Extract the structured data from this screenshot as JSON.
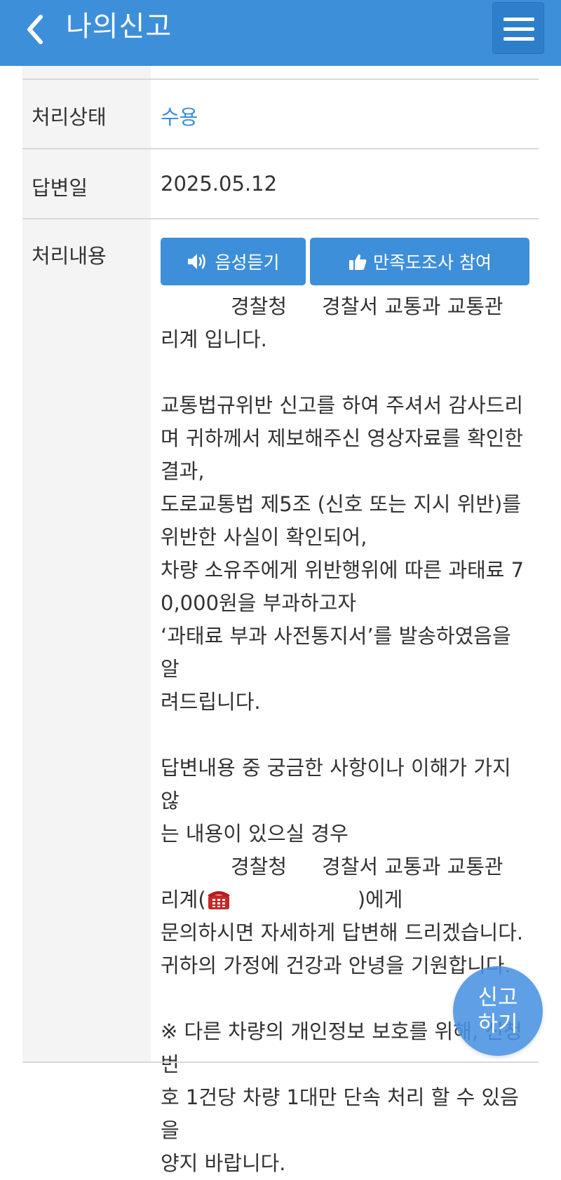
{
  "header": {
    "title": "나의신고"
  },
  "detail": {
    "rows": [
      {
        "label": "처리상태",
        "value": "수용"
      },
      {
        "label": "답변일",
        "value": "2025.05.12"
      },
      {
        "label": "처리내용"
      }
    ]
  },
  "buttons": {
    "audio_label": "음성듣기",
    "survey_label": "만족도조사 참여"
  },
  "content_lines": {
    "l1_a": "경찰청",
    "l1_b": "경찰서 교통과 교통관",
    "l2": "리계 입니다.",
    "l3": "교통법규위반 신고를 하여 주셔서 감사드리",
    "l4": "며 귀하께서 제보해주신 영상자료를 확인한",
    "l5": "결과,",
    "l6": "도로교통법 제5조 (신호 또는 지시 위반)를",
    "l7": "위반한 사실이 확인되어,",
    "l8": "차량 소유주에게 위반행위에 따른 과태료 7",
    "l9": "0,000원을 부과하고자",
    "l10": "‘과태료 부과 사전통지서’를 발송하였음을 알",
    "l11": "려드립니다.",
    "l12": "답변내용 중 궁금한 사항이나 이해가 가지 않",
    "l13": "는 내용이 있으실 경우",
    "l14_a": "경찰청",
    "l14_b": "경찰서 교통과 교통관",
    "l15_a": "리계(",
    "l15_b": ")에게",
    "l16": "문의하시면 자세하게 답변해 드리겠습니다.",
    "l17": "귀하의 가정에 건강과 안녕을 기원합니다.",
    "l18": "※ 다른 차량의 개인정보 보호를 위해, 신청번",
    "l19": "호 1건당 차량 1대만 단속 처리 할 수 있음을",
    "l20": "양지 바랍니다."
  },
  "fab": {
    "line1": "신고",
    "line2": "하기"
  },
  "colors": {
    "primary": "#3d8fd9",
    "label_bg": "#f4f4f4",
    "divider": "#d8d8d8"
  }
}
